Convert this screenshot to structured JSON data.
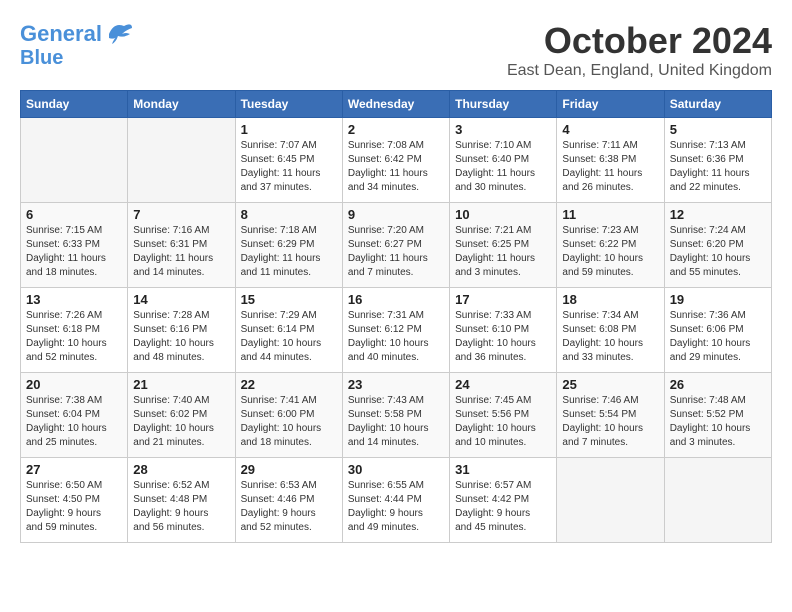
{
  "header": {
    "logo_line1": "General",
    "logo_line2": "Blue",
    "month_title": "October 2024",
    "location": "East Dean, England, United Kingdom"
  },
  "days_of_week": [
    "Sunday",
    "Monday",
    "Tuesday",
    "Wednesday",
    "Thursday",
    "Friday",
    "Saturday"
  ],
  "weeks": [
    [
      {
        "day": "",
        "info": ""
      },
      {
        "day": "",
        "info": ""
      },
      {
        "day": "1",
        "info": "Sunrise: 7:07 AM\nSunset: 6:45 PM\nDaylight: 11 hours\nand 37 minutes."
      },
      {
        "day": "2",
        "info": "Sunrise: 7:08 AM\nSunset: 6:42 PM\nDaylight: 11 hours\nand 34 minutes."
      },
      {
        "day": "3",
        "info": "Sunrise: 7:10 AM\nSunset: 6:40 PM\nDaylight: 11 hours\nand 30 minutes."
      },
      {
        "day": "4",
        "info": "Sunrise: 7:11 AM\nSunset: 6:38 PM\nDaylight: 11 hours\nand 26 minutes."
      },
      {
        "day": "5",
        "info": "Sunrise: 7:13 AM\nSunset: 6:36 PM\nDaylight: 11 hours\nand 22 minutes."
      }
    ],
    [
      {
        "day": "6",
        "info": "Sunrise: 7:15 AM\nSunset: 6:33 PM\nDaylight: 11 hours\nand 18 minutes."
      },
      {
        "day": "7",
        "info": "Sunrise: 7:16 AM\nSunset: 6:31 PM\nDaylight: 11 hours\nand 14 minutes."
      },
      {
        "day": "8",
        "info": "Sunrise: 7:18 AM\nSunset: 6:29 PM\nDaylight: 11 hours\nand 11 minutes."
      },
      {
        "day": "9",
        "info": "Sunrise: 7:20 AM\nSunset: 6:27 PM\nDaylight: 11 hours\nand 7 minutes."
      },
      {
        "day": "10",
        "info": "Sunrise: 7:21 AM\nSunset: 6:25 PM\nDaylight: 11 hours\nand 3 minutes."
      },
      {
        "day": "11",
        "info": "Sunrise: 7:23 AM\nSunset: 6:22 PM\nDaylight: 10 hours\nand 59 minutes."
      },
      {
        "day": "12",
        "info": "Sunrise: 7:24 AM\nSunset: 6:20 PM\nDaylight: 10 hours\nand 55 minutes."
      }
    ],
    [
      {
        "day": "13",
        "info": "Sunrise: 7:26 AM\nSunset: 6:18 PM\nDaylight: 10 hours\nand 52 minutes."
      },
      {
        "day": "14",
        "info": "Sunrise: 7:28 AM\nSunset: 6:16 PM\nDaylight: 10 hours\nand 48 minutes."
      },
      {
        "day": "15",
        "info": "Sunrise: 7:29 AM\nSunset: 6:14 PM\nDaylight: 10 hours\nand 44 minutes."
      },
      {
        "day": "16",
        "info": "Sunrise: 7:31 AM\nSunset: 6:12 PM\nDaylight: 10 hours\nand 40 minutes."
      },
      {
        "day": "17",
        "info": "Sunrise: 7:33 AM\nSunset: 6:10 PM\nDaylight: 10 hours\nand 36 minutes."
      },
      {
        "day": "18",
        "info": "Sunrise: 7:34 AM\nSunset: 6:08 PM\nDaylight: 10 hours\nand 33 minutes."
      },
      {
        "day": "19",
        "info": "Sunrise: 7:36 AM\nSunset: 6:06 PM\nDaylight: 10 hours\nand 29 minutes."
      }
    ],
    [
      {
        "day": "20",
        "info": "Sunrise: 7:38 AM\nSunset: 6:04 PM\nDaylight: 10 hours\nand 25 minutes."
      },
      {
        "day": "21",
        "info": "Sunrise: 7:40 AM\nSunset: 6:02 PM\nDaylight: 10 hours\nand 21 minutes."
      },
      {
        "day": "22",
        "info": "Sunrise: 7:41 AM\nSunset: 6:00 PM\nDaylight: 10 hours\nand 18 minutes."
      },
      {
        "day": "23",
        "info": "Sunrise: 7:43 AM\nSunset: 5:58 PM\nDaylight: 10 hours\nand 14 minutes."
      },
      {
        "day": "24",
        "info": "Sunrise: 7:45 AM\nSunset: 5:56 PM\nDaylight: 10 hours\nand 10 minutes."
      },
      {
        "day": "25",
        "info": "Sunrise: 7:46 AM\nSunset: 5:54 PM\nDaylight: 10 hours\nand 7 minutes."
      },
      {
        "day": "26",
        "info": "Sunrise: 7:48 AM\nSunset: 5:52 PM\nDaylight: 10 hours\nand 3 minutes."
      }
    ],
    [
      {
        "day": "27",
        "info": "Sunrise: 6:50 AM\nSunset: 4:50 PM\nDaylight: 9 hours\nand 59 minutes."
      },
      {
        "day": "28",
        "info": "Sunrise: 6:52 AM\nSunset: 4:48 PM\nDaylight: 9 hours\nand 56 minutes."
      },
      {
        "day": "29",
        "info": "Sunrise: 6:53 AM\nSunset: 4:46 PM\nDaylight: 9 hours\nand 52 minutes."
      },
      {
        "day": "30",
        "info": "Sunrise: 6:55 AM\nSunset: 4:44 PM\nDaylight: 9 hours\nand 49 minutes."
      },
      {
        "day": "31",
        "info": "Sunrise: 6:57 AM\nSunset: 4:42 PM\nDaylight: 9 hours\nand 45 minutes."
      },
      {
        "day": "",
        "info": ""
      },
      {
        "day": "",
        "info": ""
      }
    ]
  ]
}
